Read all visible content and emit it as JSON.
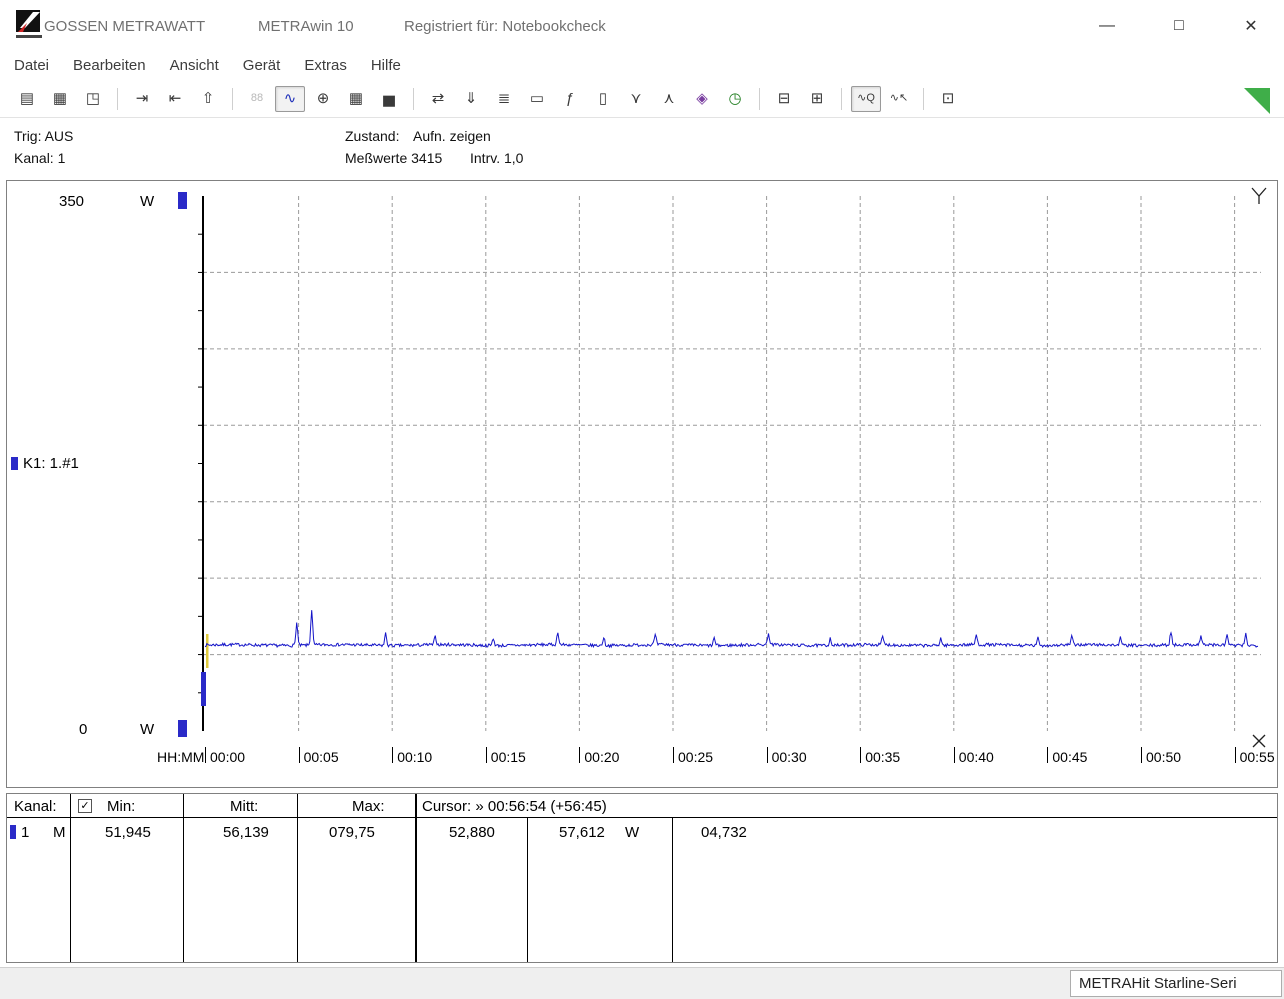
{
  "titlebar": {
    "brand": "GOSSEN METRAWATT",
    "app": "METRAwin 10",
    "registered": "Registriert für: Notebookcheck",
    "window_controls": {
      "minimize": "—",
      "maximize": "□",
      "close": "✕"
    }
  },
  "menubar": {
    "items": [
      "Datei",
      "Bearbeiten",
      "Ansicht",
      "Gerät",
      "Extras",
      "Hilfe"
    ]
  },
  "toolbar": {
    "groups": [
      {
        "buttons": [
          {
            "name": "save",
            "glyph": "▤"
          },
          {
            "name": "save-as",
            "glyph": "▦"
          },
          {
            "name": "open",
            "glyph": "◳"
          }
        ]
      },
      {
        "buttons": [
          {
            "name": "export-values",
            "glyph": "⇥"
          },
          {
            "name": "export-report",
            "glyph": "⇤"
          },
          {
            "name": "export-copy",
            "glyph": "⇧"
          }
        ]
      },
      {
        "buttons": [
          {
            "name": "view-numeric",
            "glyph": "88",
            "color": "#b8b8b8"
          },
          {
            "name": "view-trend",
            "glyph": "∿",
            "pressed": true,
            "color": "#2233bb"
          },
          {
            "name": "view-xy",
            "glyph": "⊕"
          },
          {
            "name": "view-table",
            "glyph": "▦"
          },
          {
            "name": "view-histogram",
            "glyph": "▅"
          }
        ]
      },
      {
        "buttons": [
          {
            "name": "device-send",
            "glyph": "⇄"
          },
          {
            "name": "device-read",
            "glyph": "⇓"
          },
          {
            "name": "device-settings",
            "glyph": "≣"
          },
          {
            "name": "device-monitor",
            "glyph": "▭"
          },
          {
            "name": "device-function",
            "glyph": "ƒ"
          },
          {
            "name": "device-display",
            "glyph": "▯"
          },
          {
            "name": "channel-split",
            "glyph": "⋎"
          },
          {
            "name": "channel-merge",
            "glyph": "⋏"
          },
          {
            "name": "colors",
            "glyph": "◈",
            "color": "#7a3fa0"
          },
          {
            "name": "timer",
            "glyph": "◷",
            "color": "#1e7d1e"
          }
        ]
      },
      {
        "buttons": [
          {
            "name": "print",
            "glyph": "⊟"
          },
          {
            "name": "print-preview",
            "glyph": "⊞"
          }
        ]
      },
      {
        "buttons": [
          {
            "name": "zoom-curve",
            "glyph": "∿Q",
            "pressed": true
          },
          {
            "name": "zoom-select",
            "glyph": "∿↖"
          }
        ]
      },
      {
        "buttons": [
          {
            "name": "annotation",
            "glyph": "⊡"
          }
        ]
      }
    ]
  },
  "status_strip": {
    "trig": "Trig: AUS",
    "kanal": "Kanal: 1",
    "zustand_label": "Zustand:",
    "zustand_value": "Aufn. zeigen",
    "messwerte": "Meßwerte 3415",
    "intrv": "Intrv. 1,0"
  },
  "chart": {
    "y_max": "350",
    "y_min": "0",
    "y_unit": "W",
    "channel_label": "K1: 1.#1",
    "x_axis_label": "HH:MM",
    "x_ticks": [
      "00:00",
      "00:05",
      "00:10",
      "00:15",
      "00:20",
      "00:25",
      "00:30",
      "00:35",
      "00:40",
      "00:45",
      "00:50",
      "00:55"
    ]
  },
  "chart_data": {
    "type": "line",
    "title": "Power consumption trend",
    "xlabel": "HH:MM",
    "ylabel": "W",
    "ylim": [
      0,
      350
    ],
    "xlim_minutes": [
      0,
      56.25
    ],
    "x_tick_interval_min": 5,
    "grid": {
      "y_step_w": 50,
      "style": "dashed"
    },
    "samples": 3415,
    "interval_s": 1.0,
    "cursor": {
      "position": "00:56:54",
      "elapsed": "+56:45",
      "value1_w": 52.88,
      "value2_w": 57.612,
      "delta_w": 4.732
    },
    "series": [
      {
        "name": "K1: 1.#1",
        "color": "#1414c8",
        "unit": "W",
        "baseline_w": 56.2,
        "noise_w": 1.0,
        "min_w": 51.945,
        "mean_w": 56.139,
        "max_w": 79.75,
        "spikes_t_min_w": [
          [
            4.9,
            71
          ],
          [
            5.7,
            79.7
          ],
          [
            9.65,
            64
          ],
          [
            12.3,
            61.5
          ],
          [
            15.4,
            61
          ],
          [
            18.85,
            64.5
          ],
          [
            21.3,
            61.5
          ],
          [
            24.05,
            62.5
          ],
          [
            27.2,
            61
          ],
          [
            30.1,
            64
          ],
          [
            33.4,
            61
          ],
          [
            36.2,
            61.5
          ],
          [
            39.3,
            61
          ],
          [
            41.2,
            62.5
          ],
          [
            44.5,
            61
          ],
          [
            46.3,
            61.5
          ],
          [
            48.9,
            61
          ],
          [
            51.6,
            65
          ],
          [
            53.2,
            62
          ],
          [
            54.6,
            63.5
          ],
          [
            55.6,
            64
          ]
        ]
      }
    ]
  },
  "table": {
    "header": {
      "kanal": "Kanal:",
      "checkbox_checked": true,
      "min": "Min:",
      "mitt": "Mitt:",
      "max": "Max:",
      "cursor": "Cursor: » 00:56:54 (+56:45)"
    },
    "row": {
      "channel": "1",
      "mode": "M",
      "min": "51,945",
      "mitt": "56,139",
      "max": "079,75",
      "cursor1": "52,880",
      "cursor2": "57,612",
      "unit": "W",
      "delta": "04,732"
    }
  },
  "statusbar": {
    "device": "METRAHit Starline-Seri"
  }
}
